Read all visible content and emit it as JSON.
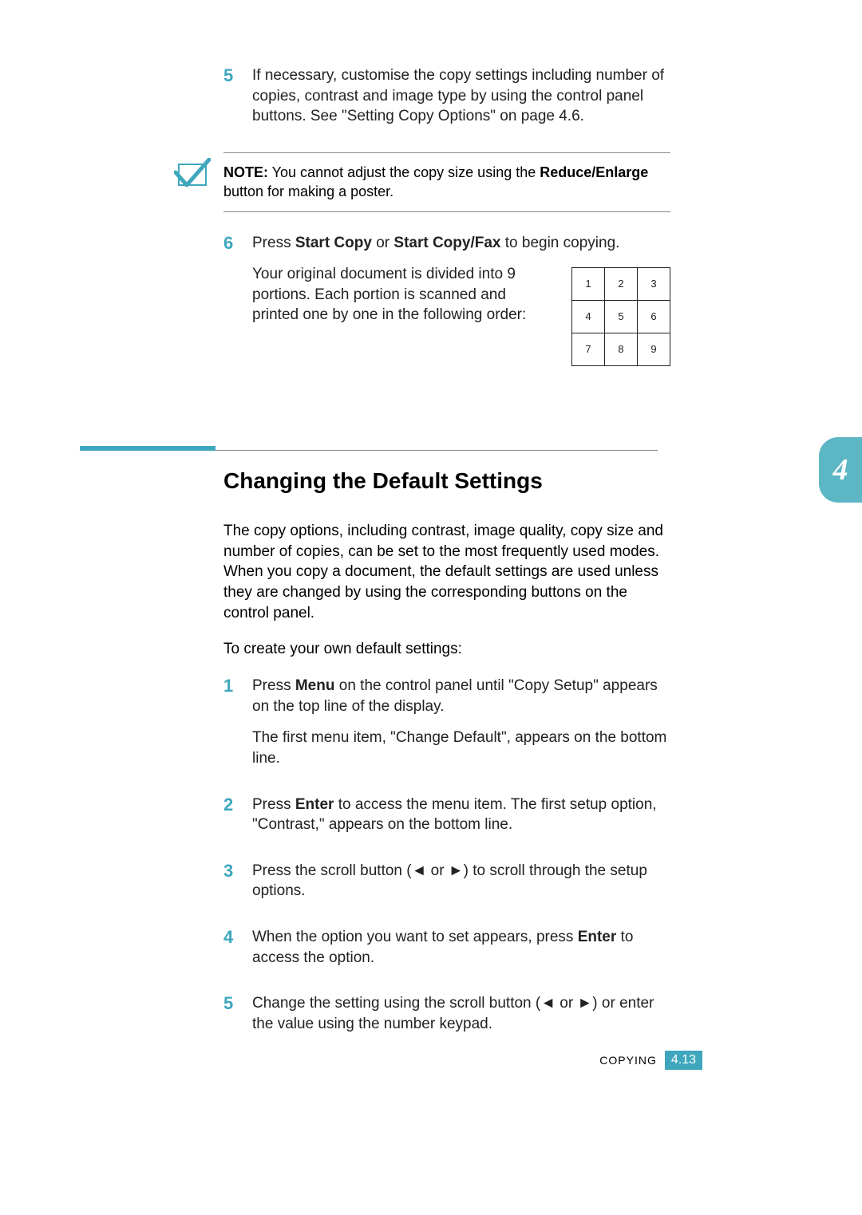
{
  "steps_top": [
    {
      "num": "5",
      "text": "If necessary, customise the copy settings including number of copies, contrast and image type by using the control panel buttons. See \"Setting Copy Options\" on page 4.6."
    }
  ],
  "note": {
    "label": "NOTE:",
    "text_before": " You cannot adjust the copy size using the ",
    "bold": "Reduce/Enlarge",
    "text_after": " button for making a poster."
  },
  "step6": {
    "num": "6",
    "line1_a": "Press ",
    "line1_b1": "Start Copy",
    "line1_c": " or ",
    "line1_b2": "Start Copy/Fax",
    "line1_d": " to begin copying.",
    "sub": "Your original document is divided into 9 portions. Each portion is scanned and printed one by one in the following order:"
  },
  "grid": [
    "1",
    "2",
    "3",
    "4",
    "5",
    "6",
    "7",
    "8",
    "9"
  ],
  "section_title": "Changing the Default Settings",
  "chapter_tab": "4",
  "intro_p": "The copy options, including contrast, image quality, copy size and number of copies, can be set to the most frequently used modes. When you copy a document, the default settings are used unless they are changed by using the corresponding buttons on the control panel.",
  "intro_p2": "To create your own default settings:",
  "steps_numbered": [
    {
      "num": "1",
      "parts": [
        "Press ",
        "Menu",
        " on the control panel until \"Copy Setup\" appears on the top line of the display."
      ],
      "sub": "The first menu item, \"Change Default\", appears on the bottom line."
    },
    {
      "num": "2",
      "parts": [
        "Press ",
        "Enter",
        " to access the menu item. The first setup option, \"Contrast,\" appears on the bottom line."
      ]
    },
    {
      "num": "3",
      "parts": [
        "Press the scroll button (◄ or ►) to scroll through the setup options."
      ]
    },
    {
      "num": "4",
      "parts": [
        "When the option you want to set appears, press ",
        "Enter",
        " to access the option."
      ]
    },
    {
      "num": "5",
      "parts": [
        "Change the setting using the scroll button (◄ or ►) or enter the value using the number keypad."
      ]
    }
  ],
  "footer": {
    "label": "COPYING",
    "page_num": "4.13"
  }
}
